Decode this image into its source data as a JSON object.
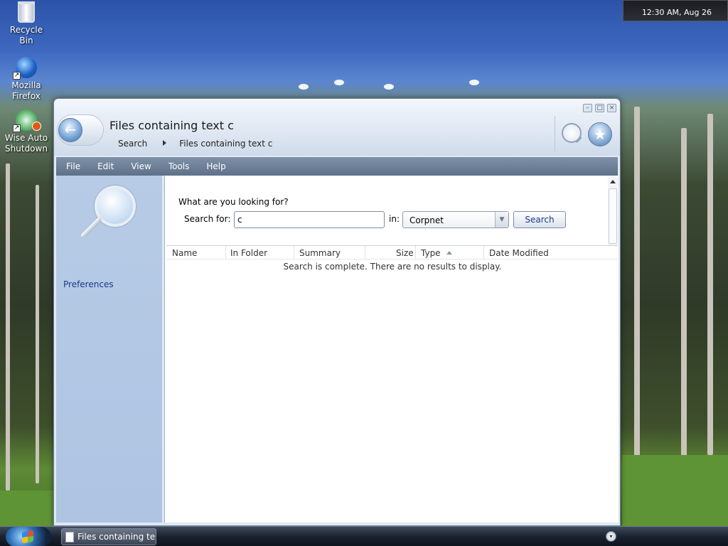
{
  "desktop": {
    "icons": [
      {
        "label": "Recycle Bin",
        "icon": "recycle-bin-icon"
      },
      {
        "label": "Mozilla Firefox",
        "icon": "firefox-icon"
      },
      {
        "label": "Wise Auto Shutdown",
        "icon": "wise-auto-shutdown-icon"
      }
    ],
    "clock_text": "12:30 AM, Aug 26"
  },
  "window": {
    "title": "Files containing text c",
    "breadcrumb": [
      "Search",
      "Files containing text c"
    ],
    "menu": [
      "File",
      "Edit",
      "View",
      "Tools",
      "Help"
    ],
    "left_pane": {
      "link": "Preferences"
    },
    "search": {
      "prompt": "What are you looking for?",
      "search_for_label": "Search for:",
      "search_for_value": "c",
      "in_label": "in:",
      "location_value": "Corpnet",
      "search_button": "Search"
    },
    "results": {
      "columns": [
        "Name",
        "In Folder",
        "Summary",
        "Size",
        "Type",
        "Date Modified"
      ],
      "sort_column": "Type",
      "empty_message": "Search is complete. There are no results to display."
    }
  },
  "taskbar": {
    "items": [
      {
        "label": "Files containing te..."
      }
    ]
  },
  "colors": {
    "menubar": "#5e7189",
    "left_pane": "#b7cbe6",
    "link": "#1b3a8a"
  }
}
